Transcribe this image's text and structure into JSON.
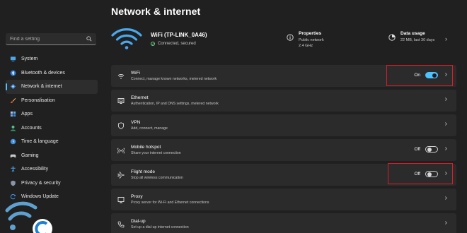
{
  "page": {
    "title": "Network & internet"
  },
  "sidebar": {
    "search_placeholder": "Find a setting",
    "items": [
      {
        "label": "System",
        "icon": "monitor-icon"
      },
      {
        "label": "Bluetooth & devices",
        "icon": "bluetooth-icon"
      },
      {
        "label": "Network & internet",
        "icon": "network-icon",
        "active": true
      },
      {
        "label": "Personalisation",
        "icon": "brush-icon"
      },
      {
        "label": "Apps",
        "icon": "apps-icon"
      },
      {
        "label": "Accounts",
        "icon": "person-icon"
      },
      {
        "label": "Time & language",
        "icon": "clock-globe-icon"
      },
      {
        "label": "Gaming",
        "icon": "gamepad-icon"
      },
      {
        "label": "Accessibility",
        "icon": "accessibility-icon"
      },
      {
        "label": "Privacy & security",
        "icon": "shield-icon"
      },
      {
        "label": "Windows Update",
        "icon": "update-icon"
      }
    ]
  },
  "hero": {
    "ssid": "WiFi (TP-LINK_0A46)",
    "status": "Connected, secured",
    "properties": {
      "title": "Properties",
      "line1": "Public network",
      "line2": "2.4 GHz"
    },
    "usage": {
      "title": "Data usage",
      "line1": "22 MB, last 30 days"
    }
  },
  "cards": [
    {
      "name": "WiFi",
      "desc": "Connect, manage known networks, metered network",
      "icon": "wifi-icon",
      "toggle": "On"
    },
    {
      "name": "Ethernet",
      "desc": "Authentication, IP and DNS settings, metered network",
      "icon": "ethernet-icon"
    },
    {
      "name": "VPN",
      "desc": "Add, connect, manage",
      "icon": "vpn-shield-icon"
    },
    {
      "name": "Mobile hotspot",
      "desc": "Share your internet connection",
      "icon": "hotspot-icon",
      "toggle": "Off"
    },
    {
      "name": "Flight mode",
      "desc": "Stop all wireless communication",
      "icon": "airplane-icon",
      "toggle": "Off"
    },
    {
      "name": "Proxy",
      "desc": "Proxy server for Wi-Fi and Ethernet connections",
      "icon": "proxy-icon"
    },
    {
      "name": "Dial-up",
      "desc": "Set up a dial-up internet connection",
      "icon": "dialup-icon"
    }
  ],
  "colors": {
    "accent": "#4cc2ff",
    "highlight": "#d81e2a",
    "background": "#202020",
    "card": "#2b2b2b"
  }
}
